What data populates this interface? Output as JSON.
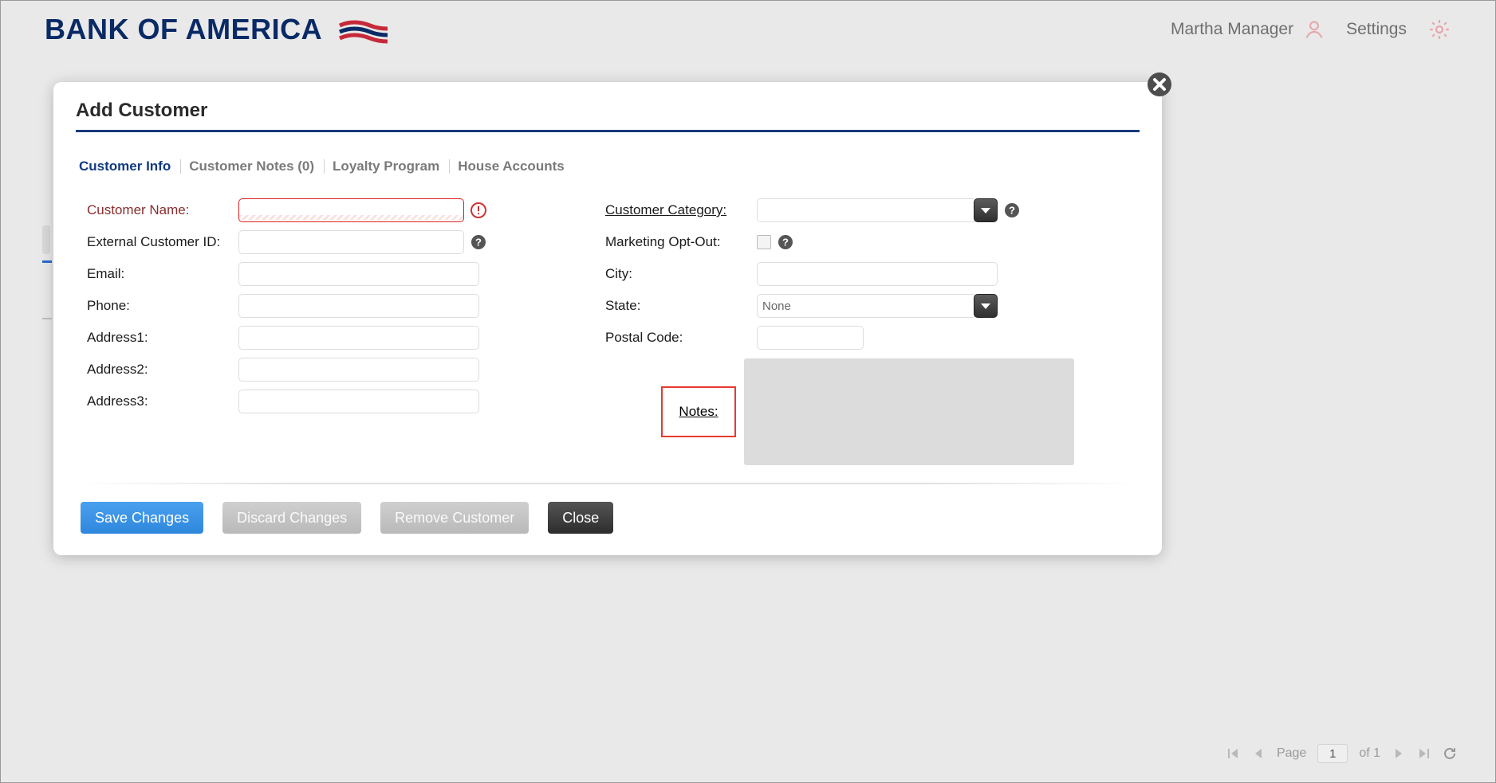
{
  "header": {
    "brand": "BANK OF AMERICA",
    "user_name": "Martha Manager",
    "settings_label": "Settings"
  },
  "modal": {
    "title": "Add Customer",
    "tabs": [
      {
        "label": "Customer Info",
        "active": true
      },
      {
        "label": "Customer Notes (0)",
        "active": false
      },
      {
        "label": "Loyalty Program",
        "active": false
      },
      {
        "label": "House Accounts",
        "active": false
      }
    ],
    "fields_left": {
      "customer_name_label": "Customer Name:",
      "customer_name_value": "",
      "external_id_label": "External Customer ID:",
      "external_id_value": "",
      "email_label": "Email:",
      "email_value": "",
      "phone_label": "Phone:",
      "phone_value": "",
      "address1_label": "Address1:",
      "address1_value": "",
      "address2_label": "Address2:",
      "address2_value": "",
      "address3_label": "Address3:",
      "address3_value": ""
    },
    "fields_right": {
      "category_label": "Customer Category:",
      "category_value": "",
      "opt_out_label": "Marketing Opt-Out:",
      "city_label": "City:",
      "city_value": "",
      "state_label": "State:",
      "state_value": "None",
      "postal_label": "Postal Code:",
      "postal_value": "",
      "notes_label": "Notes:",
      "notes_value": ""
    },
    "buttons": {
      "save": "Save Changes",
      "discard": "Discard Changes",
      "remove": "Remove Customer",
      "close": "Close"
    }
  },
  "pager": {
    "page_label": "Page",
    "page_value": "1",
    "of_label": "of 1"
  }
}
